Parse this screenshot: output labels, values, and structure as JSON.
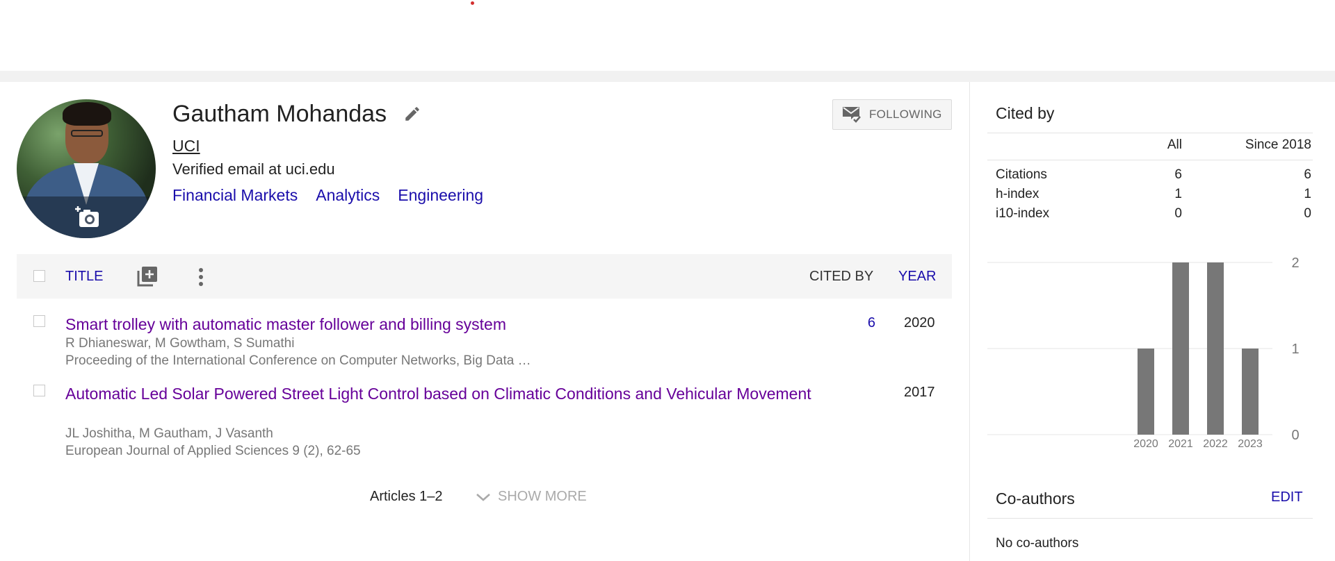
{
  "profile": {
    "name": "Gautham Mohandas",
    "affiliation": "UCI",
    "email": "Verified email at uci.edu",
    "interests": [
      "Financial Markets",
      "Analytics",
      "Engineering"
    ],
    "follow_label": "FOLLOWING"
  },
  "table": {
    "header": {
      "title": "TITLE",
      "cited_by": "CITED BY",
      "year": "YEAR"
    },
    "articles": [
      {
        "title": "Smart trolley with automatic master follower and billing system",
        "authors": "R Dhianeswar, M Gowtham, S Sumathi",
        "venue": "Proceeding of the International Conference on Computer Networks, Big Data …",
        "cited_by": "6",
        "year": "2020"
      },
      {
        "title": "Automatic Led Solar Powered Street Light Control based on Climatic Conditions and Vehicular Movement",
        "authors": "JL Joshitha, M Gautham, J Vasanth",
        "venue": "European Journal of Applied Sciences 9 (2), 62-65",
        "cited_by": "",
        "year": "2017"
      }
    ],
    "footer": {
      "range": "Articles 1–2",
      "show_more": "SHOW MORE"
    }
  },
  "cited_by": {
    "title": "Cited by",
    "columns": [
      "All",
      "Since 2018"
    ],
    "rows": [
      {
        "label": "Citations",
        "all": "6",
        "since": "6"
      },
      {
        "label": "h-index",
        "all": "1",
        "since": "1"
      },
      {
        "label": "i10-index",
        "all": "0",
        "since": "0"
      }
    ]
  },
  "chart_data": {
    "type": "bar",
    "categories": [
      "2020",
      "2021",
      "2022",
      "2023"
    ],
    "values": [
      1,
      2,
      2,
      1
    ],
    "ylim": [
      0,
      2
    ],
    "yticks": [
      "0",
      "1",
      "2"
    ],
    "title": "",
    "xlabel": "",
    "ylabel": "",
    "grid": true,
    "bar_color": "#777777"
  },
  "coauthors": {
    "title": "Co-authors",
    "edit_label": "EDIT",
    "empty_text": "No co-authors"
  },
  "colors": {
    "link": "#1a0dab",
    "visited": "#660099",
    "band": "#f1f1f1"
  }
}
